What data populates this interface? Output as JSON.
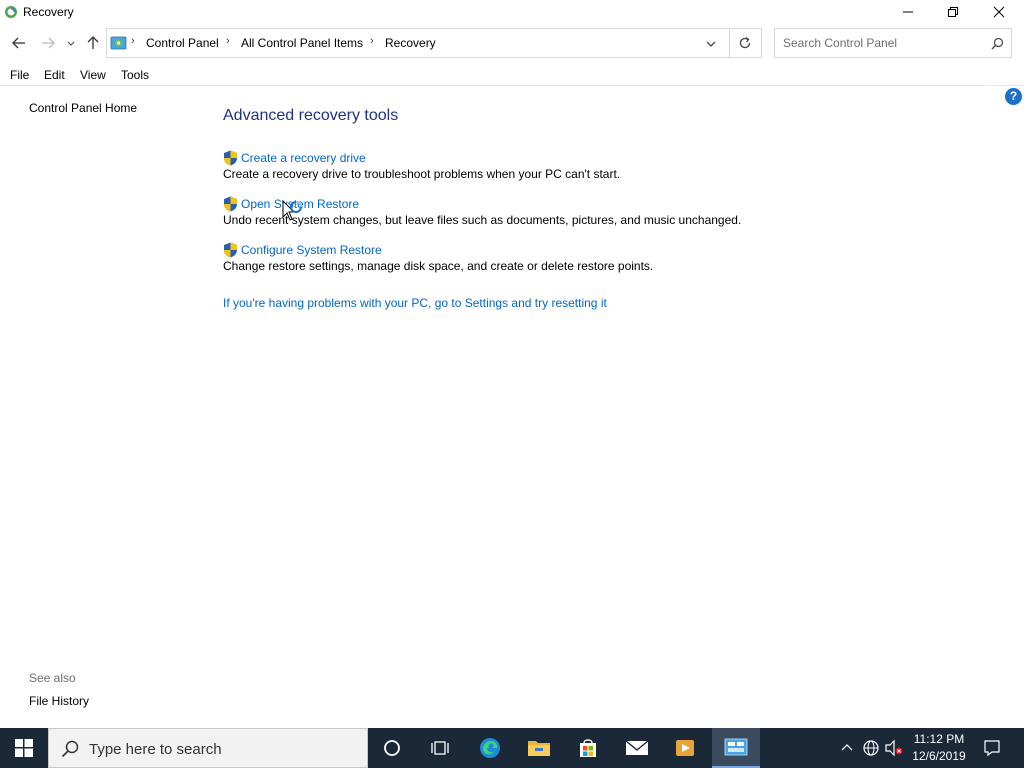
{
  "window": {
    "title": "Recovery"
  },
  "address": {
    "crumbs": [
      "Control Panel",
      "All Control Panel Items",
      "Recovery"
    ]
  },
  "search": {
    "placeholder": "Search Control Panel"
  },
  "menu": {
    "items": [
      "File",
      "Edit",
      "View",
      "Tools"
    ]
  },
  "left_pane": {
    "home_link": "Control Panel Home",
    "see_also_label": "See also",
    "see_also_items": [
      "File History"
    ]
  },
  "main": {
    "title": "Advanced recovery tools",
    "tasks": [
      {
        "link": "Create a recovery drive",
        "description": "Create a recovery drive to troubleshoot problems when your PC can't start."
      },
      {
        "link": "Open System Restore",
        "description": "Undo recent system changes, but leave files such as documents, pictures, and music unchanged."
      },
      {
        "link": "Configure System Restore",
        "description": "Change restore settings, manage disk space, and create or delete restore points."
      }
    ],
    "reset_link": "If you're having problems with your PC, go to Settings and try resetting it",
    "help_glyph": "?"
  },
  "taskbar": {
    "search_placeholder": "Type here to search",
    "apps": [
      "task-view",
      "edge",
      "file-explorer",
      "store",
      "mail",
      "media-player",
      "control-panel"
    ],
    "active_app": "control-panel",
    "clock_time": "11:12 PM",
    "clock_date": "12/6/2019"
  },
  "colors": {
    "link": "#0066cc",
    "heading": "#1e3287",
    "taskbar": "#1b2838",
    "accent": "#1e6fc9"
  }
}
